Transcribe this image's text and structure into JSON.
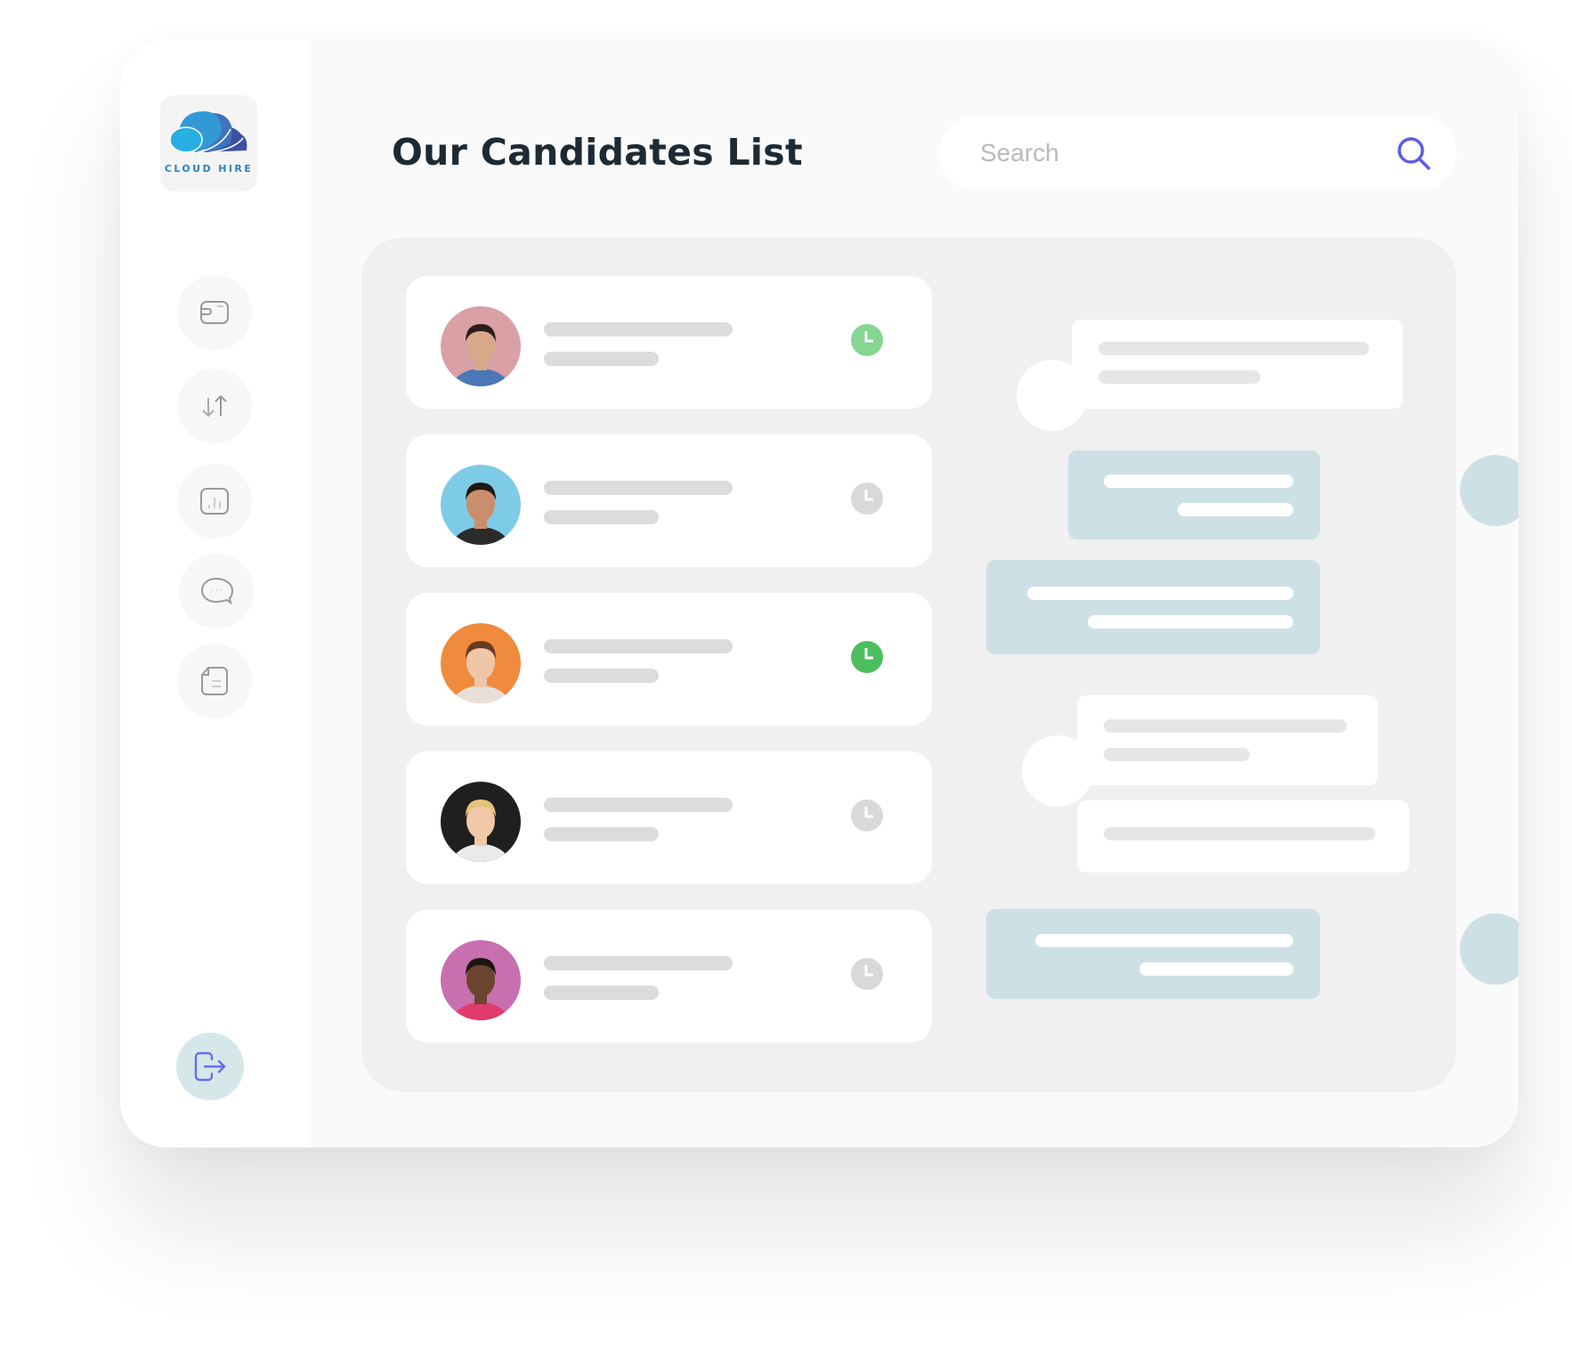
{
  "app": {
    "logo_text": "CLOUD HIRE"
  },
  "sidebar": {
    "items": [
      {
        "icon": "wallet-icon"
      },
      {
        "icon": "transfer-arrows-icon"
      },
      {
        "icon": "chart-icon"
      },
      {
        "icon": "chat-bubble-icon"
      },
      {
        "icon": "document-icon"
      }
    ],
    "logout_icon": "logout-icon"
  },
  "header": {
    "title": "Our Candidates List",
    "search": {
      "placeholder": "Search",
      "value": ""
    }
  },
  "colors": {
    "accent": "#5b5ce8",
    "status_active": "#4cbe5e",
    "status_active_light": "#86d593",
    "status_inactive": "#d9d9d9",
    "bubble_blue": "#cde0e6",
    "logout_bg": "#d6e7ea"
  },
  "candidates": [
    {
      "avatar_bg": "#d9a0a6",
      "skin": "#d9a88a",
      "hair": "#2a1e1a",
      "shirt": "#4a78b8",
      "status": "active",
      "status_color": "#86d593"
    },
    {
      "avatar_bg": "#7ecbe8",
      "skin": "#c98f6c",
      "hair": "#1f1813",
      "shirt": "#2b2b2b",
      "status": "inactive",
      "status_color": "#d9d9d9"
    },
    {
      "avatar_bg": "#f08a3c",
      "skin": "#f0c6a8",
      "hair": "#6b3a22",
      "shirt": "#e8e0d8",
      "status": "active",
      "status_color": "#4cbe5e"
    },
    {
      "avatar_bg": "#1f1f1f",
      "skin": "#f1c9a9",
      "hair": "#e7c27d",
      "shirt": "#eaeaea",
      "status": "inactive",
      "status_color": "#d9d9d9"
    },
    {
      "avatar_bg": "#c86fb0",
      "skin": "#6b4530",
      "hair": "#1c1410",
      "shirt": "#e23a6a",
      "status": "inactive",
      "status_color": "#d9d9d9"
    }
  ]
}
